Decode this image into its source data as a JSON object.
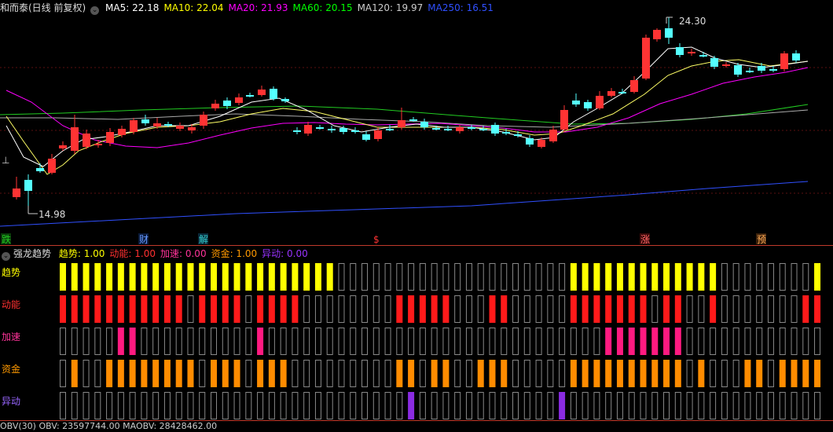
{
  "main_panel": {
    "title": "和而泰(日线 前复权)",
    "ma_legend": [
      {
        "label": "MA5: 22.18",
        "color": "#ffffff"
      },
      {
        "label": "MA10: 22.04",
        "color": "#ffff00"
      },
      {
        "label": "MA20: 21.93",
        "color": "#ff00ff"
      },
      {
        "label": "MA60: 20.15",
        "color": "#00ff00"
      },
      {
        "label": "MA120: 19.97",
        "color": "#cccccc"
      },
      {
        "label": "MA250: 16.51",
        "color": "#3050ff"
      }
    ],
    "high_label": "24.30",
    "low_label": "14.98",
    "markers": [
      {
        "text": "跌",
        "color": "#22cc22",
        "bg": "#0a3a0a"
      },
      {
        "text": "财",
        "color": "#6699ff",
        "bg": "#0a1a3a"
      },
      {
        "text": "解",
        "color": "#33cccc",
        "bg": "#0a2a3a"
      },
      {
        "text": "$",
        "color": "#ff3333",
        "bg": "#000000"
      },
      {
        "text": "涨",
        "color": "#ff6666",
        "bg": "#3a0a0a"
      },
      {
        "text": "预",
        "color": "#ffaa55",
        "bg": "#3a200a"
      }
    ]
  },
  "indicator_panel": {
    "title": "强龙趋势",
    "legend": [
      {
        "label": "趋势: 1.00",
        "color": "#ffff00"
      },
      {
        "label": "动能: 1.00",
        "color": "#ff3030"
      },
      {
        "label": "加速: 0.00",
        "color": "#ff3399"
      },
      {
        "label": "资金: 1.00",
        "color": "#ff9900"
      },
      {
        "label": "异动: 0.00",
        "color": "#9933ff"
      }
    ],
    "rows": [
      {
        "name": "趋势",
        "color": "#ffff00",
        "label_color": "#ffff00"
      },
      {
        "name": "动能",
        "color": "#ff1a1a",
        "label_color": "#ff3030"
      },
      {
        "name": "加速",
        "color": "#ff1a80",
        "label_color": "#ff3399"
      },
      {
        "name": "资金",
        "color": "#ff8c00",
        "label_color": "#ff9900"
      },
      {
        "name": "异动",
        "color": "#8a2be2",
        "label_color": "#9966ff"
      }
    ]
  },
  "bottom_panel": {
    "legend_text": "OBV(30)  OBV: 23597744.00  MAOBV: 28428462.00"
  },
  "colors": {
    "up": "#ff3333",
    "down": "#54ffff",
    "grid": "#5a1010",
    "divider": "#b03020"
  }
}
